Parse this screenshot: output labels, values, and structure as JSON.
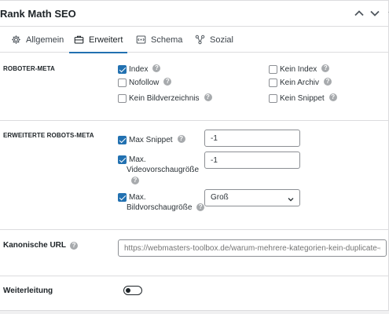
{
  "header": {
    "title": "Rank Math SEO"
  },
  "tabs": [
    {
      "label": "Allgemein",
      "icon": "gear-icon",
      "active": false
    },
    {
      "label": "Erweitert",
      "icon": "briefcase-icon",
      "active": true
    },
    {
      "label": "Schema",
      "icon": "schema-icon",
      "active": false
    },
    {
      "label": "Sozial",
      "icon": "social-icon",
      "active": false
    }
  ],
  "robots_meta": {
    "label": "ROBOTER-META",
    "options": [
      {
        "label": "Index",
        "checked": true,
        "help": true
      },
      {
        "label": "Kein Index",
        "checked": false,
        "help": true
      },
      {
        "label": "Nofollow",
        "checked": false,
        "help": true
      },
      {
        "label": "Kein Archiv",
        "checked": false,
        "help": true
      },
      {
        "label": "Kein Bildverzeichnis",
        "checked": false,
        "help": true
      },
      {
        "label": "Kein Snippet",
        "checked": false,
        "help": true
      }
    ]
  },
  "advanced_robots": {
    "label": "ERWEITERTE ROBOTS-META",
    "max_snippet": {
      "label": "Max Snippet",
      "checked": true,
      "value": "-1"
    },
    "max_video": {
      "label_line1": "Max.",
      "label_line2": "Videovorschaugröße",
      "checked": true,
      "value": "-1"
    },
    "max_image": {
      "label_line1": "Max.",
      "label_line2": "Bildvorschaugröße",
      "checked": true,
      "value": "Groß"
    }
  },
  "canonical": {
    "label": "Kanonische URL",
    "placeholder": "https://webmasters-toolbox.de/warum-mehrere-kategorien-kein-duplicate-cc"
  },
  "redirect": {
    "label": "Weiterleitung",
    "enabled": false
  },
  "colors": {
    "accent": "#2271b1",
    "border": "#dcdcde",
    "help": "#a7aaad"
  }
}
